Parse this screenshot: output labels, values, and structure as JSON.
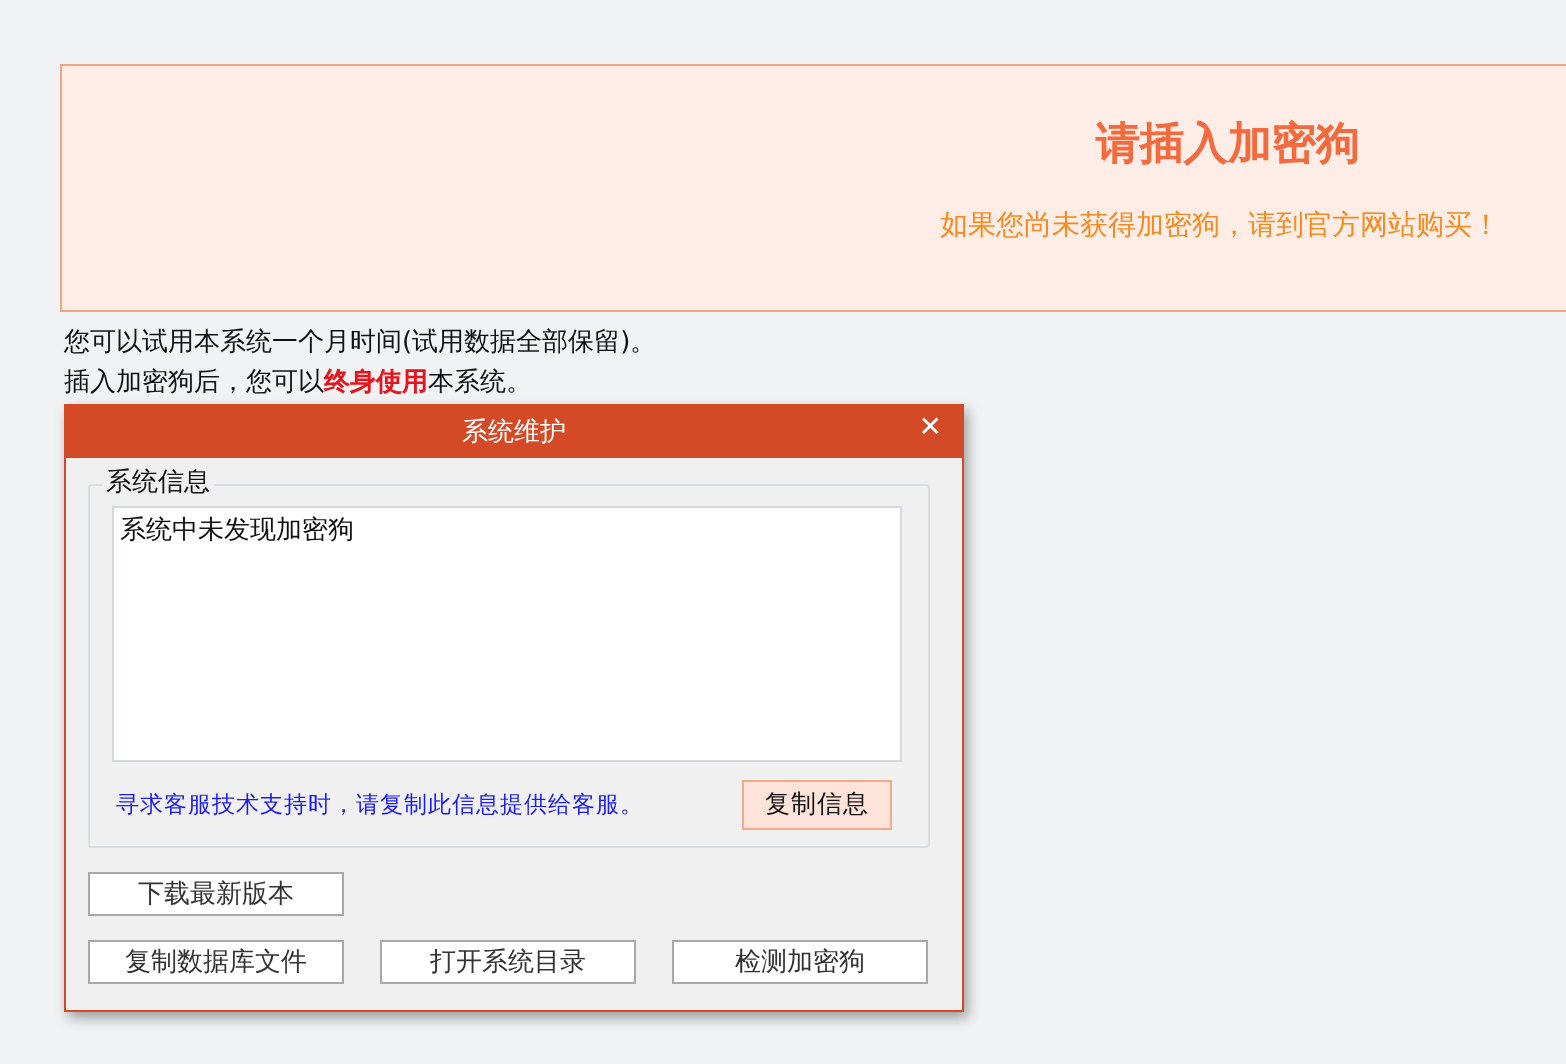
{
  "banner": {
    "title": "请插入加密狗",
    "subtitle": "如果您尚未获得加密狗，请到官方网站购买！"
  },
  "notes": [
    "您可以试用本系统一个月时间(试用数据全部保留)。",
    "插入加密狗后，您可以**终身使用**本系统。"
  ],
  "dialog": {
    "title": "系统维护",
    "close": "✕",
    "group_label": "系统信息",
    "info": "系统中未发现加密狗",
    "hint": "寻求客服技术支持时，请复制此信息提供给客服。",
    "copy_button": "复制信息",
    "buttons": [
      [
        "下载最新版本"
      ],
      [
        "复制数据库文件",
        "打开系统目录",
        "检测加密狗"
      ]
    ]
  }
}
